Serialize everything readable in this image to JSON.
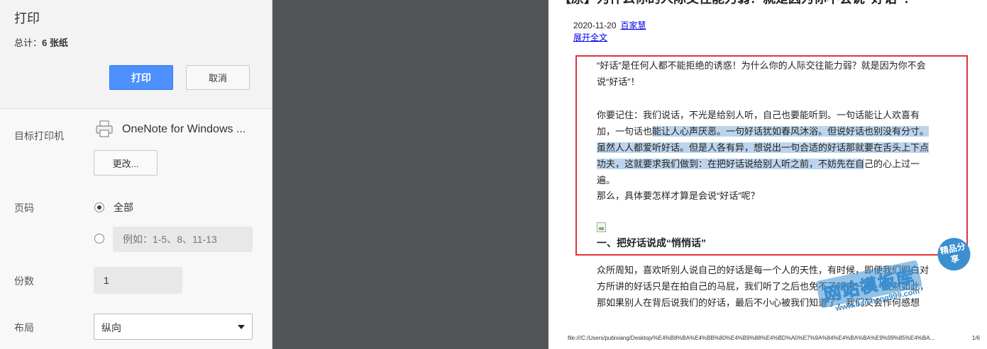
{
  "panel": {
    "title": "打印",
    "total_label": "总计：",
    "total_value": "6 张纸",
    "print_button": "打印",
    "cancel_button": "取消",
    "printer": {
      "label": "目标打印机",
      "name": "OneNote for Windows ...",
      "change_button": "更改..."
    },
    "pages": {
      "label": "页码",
      "all_option": "全部",
      "custom_placeholder": "例如：1-5、8、11-13"
    },
    "copies": {
      "label": "份数",
      "value": "1"
    },
    "layout": {
      "label": "布局",
      "value": "纵向"
    }
  },
  "preview": {
    "title": "【原】为什么你的人际交往能力弱？就是因为你不会说“好话”！",
    "date": "2020-11-20",
    "source_link": "百家慧",
    "expand_link": "展开全文",
    "para1": "“好话”是任何人都不能拒绝的诱惑！为什么你的人际交往能力弱？就是因为你不会说“好话”！",
    "para2_start": "你要记住：我们说话，不光是给别人听，自己也要能听到。一句话能让人欢喜有加，一句话也",
    "para2_highlight": "能让人心声厌恶。一句好话犹如春风沐浴。但说好话也别没有分寸。虽然人人都爱听好话。但是人各有异，想说出一句合适的好话那就要在舌头上下点功夫，这就要求我们做到：在把好话说给别人听之前，不妨先在自",
    "para2_end": "己的心上过一遍。",
    "para3": "那么，具体要怎样才算是会说“好话”呢？",
    "section_heading": "一、把好话说成“悄悄话”",
    "para4": "众所周知，喜欢听别人说自己的好话是每一个人的天性，有时候，即便我们明白对方所讲的好话只是在拍自己的马屁，我们听了之后也免不了暗爽一番。既然如此，那如果别人在背后说我们的好话，最后不小心被我们知道了，我们又会作何感想",
    "footer_url": "file:///C:/Users/pubixiang/Desktop/%E4%B8%BA%E4%BB%80%E4%B9%88%E4%BD%A0%E7%9A%84%E4%BA%BA%E9%99%85%E4%BA...",
    "footer_page": "1/6"
  },
  "watermark": {
    "main": "网站模板库",
    "badge": "精品分享",
    "url": "www.baisheng999.com"
  },
  "colors": {
    "print_button": "#4d90fe",
    "preview_background": "#525659",
    "red_box": "#e0353a",
    "highlight": "#bcd4ec"
  }
}
